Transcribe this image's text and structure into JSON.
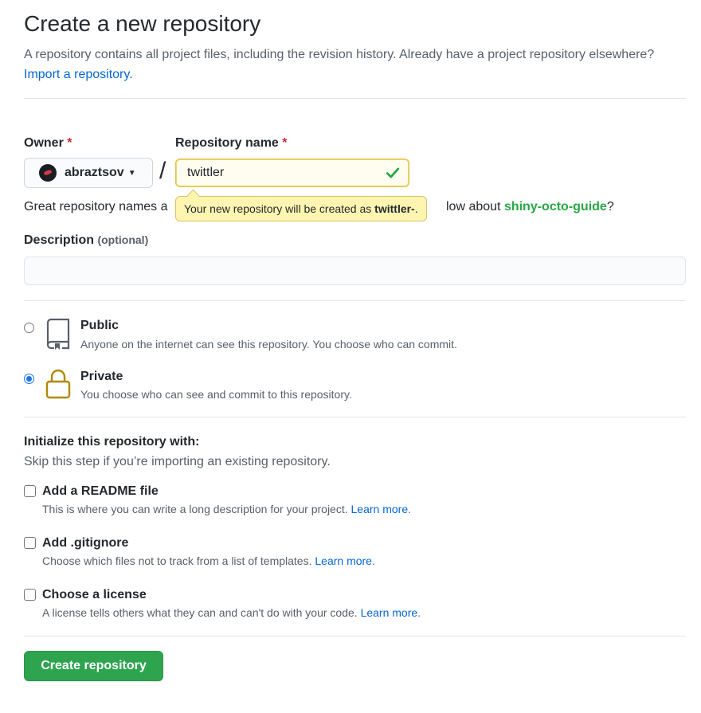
{
  "header": {
    "title": "Create a new repository",
    "intro": "A repository contains all project files, including the revision history. Already have a project repository elsewhere?",
    "import_link": "Import a repository."
  },
  "owner": {
    "label": "Owner",
    "required_mark": "*",
    "value": "abraztsov",
    "avatar_icon": "user-avatar",
    "caret_icon": "caret-down-icon"
  },
  "separator": "/",
  "repo_name": {
    "label": "Repository name",
    "required_mark": "*",
    "value": "twittler",
    "status_icon": "check-icon",
    "status_color": "#28a745"
  },
  "naming_hint": {
    "text": "Great repository names a",
    "suggest_prefix": "low about ",
    "suggestion": "shiny-octo-guide",
    "suffix": "?"
  },
  "tooltip": {
    "prefix": "Your new repository will be created as ",
    "name": "twittler-",
    "suffix": "."
  },
  "description": {
    "label": "Description",
    "optional": "(optional)",
    "value": ""
  },
  "visibility": {
    "selected": "private",
    "options": [
      {
        "id": "public",
        "title": "Public",
        "description": "Anyone on the internet can see this repository. You choose who can commit.",
        "icon": "repo-icon"
      },
      {
        "id": "private",
        "title": "Private",
        "description": "You choose who can see and commit to this repository.",
        "icon": "lock-icon"
      }
    ]
  },
  "initialize": {
    "title": "Initialize this repository with:",
    "subtitle": "Skip this step if you’re importing an existing repository.",
    "learn_more": "Learn more",
    "options": [
      {
        "title": "Add a README file",
        "description": "This is where you can write a long description for your project.",
        "checked": false
      },
      {
        "title": "Add .gitignore",
        "description": "Choose which files not to track from a list of templates.",
        "checked": false
      },
      {
        "title": "Choose a license",
        "description": "A license tells others what they can and can't do with your code.",
        "checked": false
      }
    ]
  },
  "submit": {
    "label": "Create repository",
    "color": "#2ea44f"
  }
}
